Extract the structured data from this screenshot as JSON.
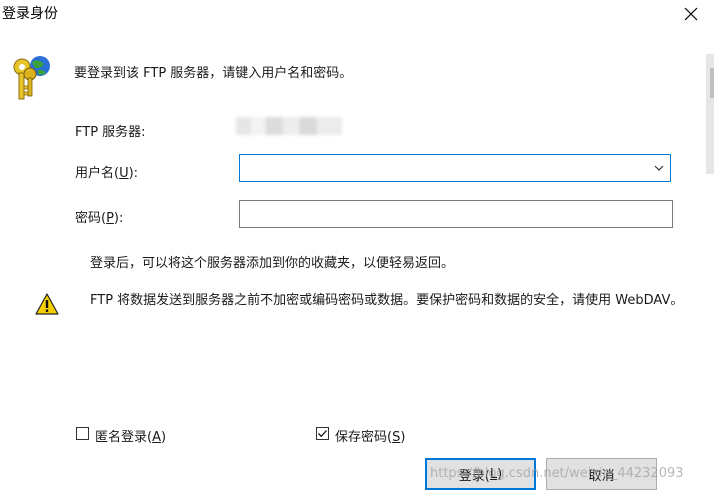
{
  "window": {
    "title": "登录身份"
  },
  "intro_text": "要登录到该 FTP 服务器，请键入用户名和密码。",
  "form": {
    "server_label": "FTP 服务器:",
    "username_label_pre": "用户名(",
    "username_label_key": "U",
    "username_label_post": "):",
    "username_value": "",
    "password_label_pre": "密码(",
    "password_label_key": "P",
    "password_label_post": "):",
    "password_value": ""
  },
  "info_text": "登录后，可以将这个服务器添加到你的收藏夹，以便轻易返回。",
  "warning_text": "FTP 将数据发送到服务器之前不加密或编码密码或数据。要保护密码和数据的安全，请使用 WebDAV。",
  "options": {
    "anonymous_pre": "匿名登录(",
    "anonymous_key": "A",
    "anonymous_post": ")",
    "anonymous_checked": false,
    "save_pre": "保存密码(",
    "save_key": "S",
    "save_post": ")",
    "save_checked": true
  },
  "buttons": {
    "login_pre": "登录(",
    "login_key": "L",
    "login_post": ")",
    "cancel": "取消"
  },
  "watermark": "https://blog.csdn.net/weixin_44232093",
  "colors": {
    "accent": "#0078d7",
    "button_bg": "#e1e1e1",
    "warning_yellow": "#f5d000"
  },
  "icons": {
    "window_close": "close-icon",
    "credentials": "keys-globe-icon",
    "warning": "warning-icon",
    "dropdown": "chevron-down-icon",
    "checkmark": "checkmark-icon"
  }
}
